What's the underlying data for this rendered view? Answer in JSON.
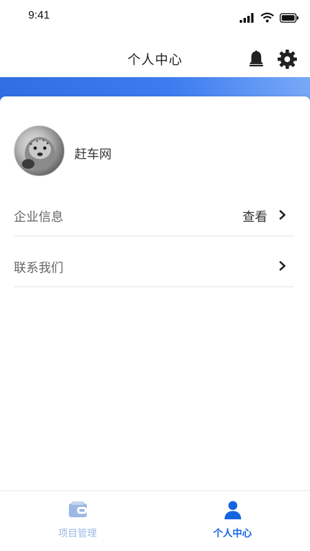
{
  "status_bar": {
    "time": "9:41",
    "icons": [
      "signal-icon",
      "wifi-icon",
      "battery-icon"
    ]
  },
  "header": {
    "title": "个人中心",
    "icons": [
      "bell-icon",
      "gear-icon"
    ]
  },
  "profile": {
    "name": "赶车网",
    "avatar": "avatar-photo"
  },
  "menu": [
    {
      "label": "企业信息",
      "value": "查看",
      "icon": "chevron-right-icon"
    },
    {
      "label": "联系我们",
      "value": "",
      "icon": "chevron-right-icon"
    }
  ],
  "tabbar": [
    {
      "label": "项目管理",
      "icon": "wallet-icon",
      "active": false
    },
    {
      "label": "个人中心",
      "icon": "person-icon",
      "active": true
    }
  ],
  "colors": {
    "accent": "#1565e0",
    "band_start": "#2f6fe3",
    "band_end": "#78a9f7",
    "tab_inactive": "#9db8e4"
  }
}
